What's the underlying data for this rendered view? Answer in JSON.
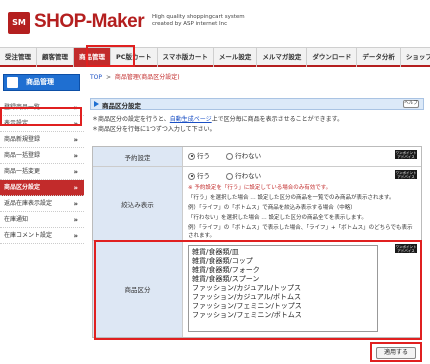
{
  "header": {
    "logo_mark": "SM",
    "logo_text": "SHOP-Maker",
    "tagline_1": "High quality shoppingcart system",
    "tagline_2": "created by ASP internet Inc"
  },
  "topnav": {
    "items": [
      {
        "label": "受注管理"
      },
      {
        "label": "顧客管理"
      },
      {
        "label": "商品管理"
      },
      {
        "label": "PC版カート"
      },
      {
        "label": "スマホ版カート"
      },
      {
        "label": "メール設定"
      },
      {
        "label": "メルマガ設定"
      },
      {
        "label": "ダウンロード"
      },
      {
        "label": "データ分析"
      },
      {
        "label": "ショップ情"
      }
    ],
    "active_index": 2
  },
  "sidebar": {
    "heading": "商品管理",
    "items": [
      {
        "label": "登録商品一覧"
      },
      {
        "label": "表示設定"
      },
      {
        "label": "商品新規登録"
      },
      {
        "label": "商品一括登録"
      },
      {
        "label": "商品一括変更"
      },
      {
        "label": "商品区分設定"
      },
      {
        "label": "返品在庫表示設定"
      },
      {
        "label": "在庫通知"
      },
      {
        "label": "在庫コメント設定"
      }
    ],
    "active_index": 5
  },
  "breadcrumb": {
    "top": "TOP",
    "sep": ">",
    "current": "商品管理(商品区分設定)"
  },
  "page": {
    "title": "商品区分設定",
    "help_label": "ヘルプ",
    "note_1_prefix": "商品区分の設定を行うと、",
    "note_1_link": "自動生成ページ",
    "note_1_suffix": "上で区分毎に商品を表示させることができます。",
    "note_2": "商品区分を行毎に1つずつ入力して下さい。"
  },
  "form": {
    "row_enable": {
      "label": "予約設定",
      "opt_yes": "行う",
      "opt_no": "行わない",
      "selected": "yes",
      "badge": "ワンポイントアドバイス"
    },
    "row_display": {
      "label": "絞込み表示",
      "opt_yes": "行う",
      "opt_no": "行わない",
      "selected": "yes",
      "badge": "ワンポイントアドバイス",
      "red_note": "※ 予約設定を「行う」に設定している場合のみ有効です。",
      "desc_1": "「行う」を選択した場合 … 設定した区分の商品を一覧でのみ商品が表示されます。",
      "desc_2": "例）「ライフ」の「ボトムス」で商品を絞込み表示する場合（中略）",
      "desc_3": "「行わない」を選択した場合 … 設定した区分の商品全てを表示します。",
      "desc_4": "例）「ライフ」の「ボトムス」で表示した場合、「ライフ」+「ボトムス」のどちらでも表示されます。"
    },
    "row_category": {
      "label": "商品区分",
      "badge": "ワンポイントアドバイス",
      "lines": [
        "雑貨/食器類/皿",
        "雑貨/食器類/コップ",
        "雑貨/食器類/フォーク",
        "雑貨/食器類/スプーン",
        "ファッション/カジュアル/トップス",
        "ファッション/カジュアル/ボトムス",
        "ファッション/フェミニン/トップス",
        "ファッション/フェミニン/ボトムス"
      ]
    }
  },
  "submit_label": "適用する"
}
